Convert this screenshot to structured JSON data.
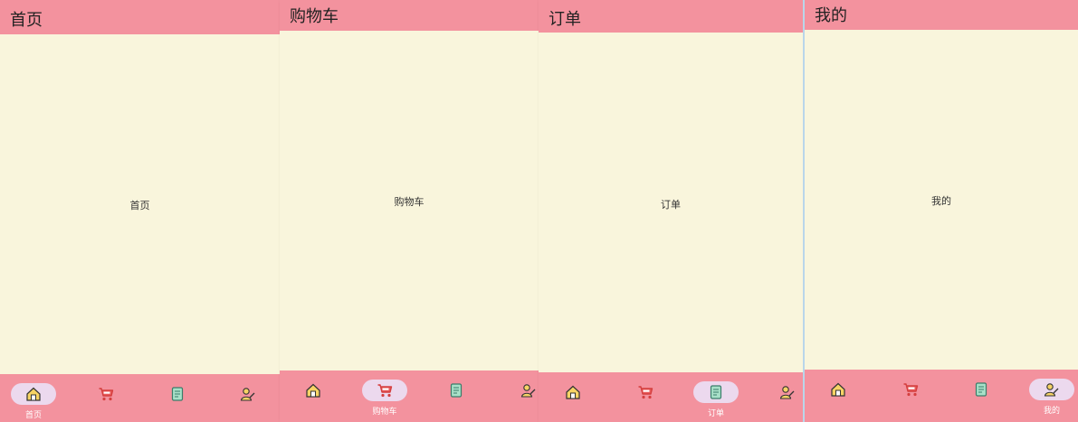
{
  "screens": [
    {
      "title": "首页",
      "body": "首页",
      "active": 0
    },
    {
      "title": "购物车",
      "body": "购物车",
      "active": 1
    },
    {
      "title": "订单",
      "body": "订单",
      "active": 2
    },
    {
      "title": "我的",
      "body": "我的",
      "active": 3
    }
  ],
  "nav": {
    "home": "首页",
    "cart": "购物车",
    "orders": "订单",
    "mine": "我的"
  },
  "icons": [
    "home-icon",
    "cart-icon",
    "order-list-icon",
    "profile-icon"
  ],
  "colors": {
    "appbar": "#f3929e",
    "background": "#f9f5dc",
    "active_pill": "#ecd9ee",
    "nav_label": "#ffffff"
  }
}
